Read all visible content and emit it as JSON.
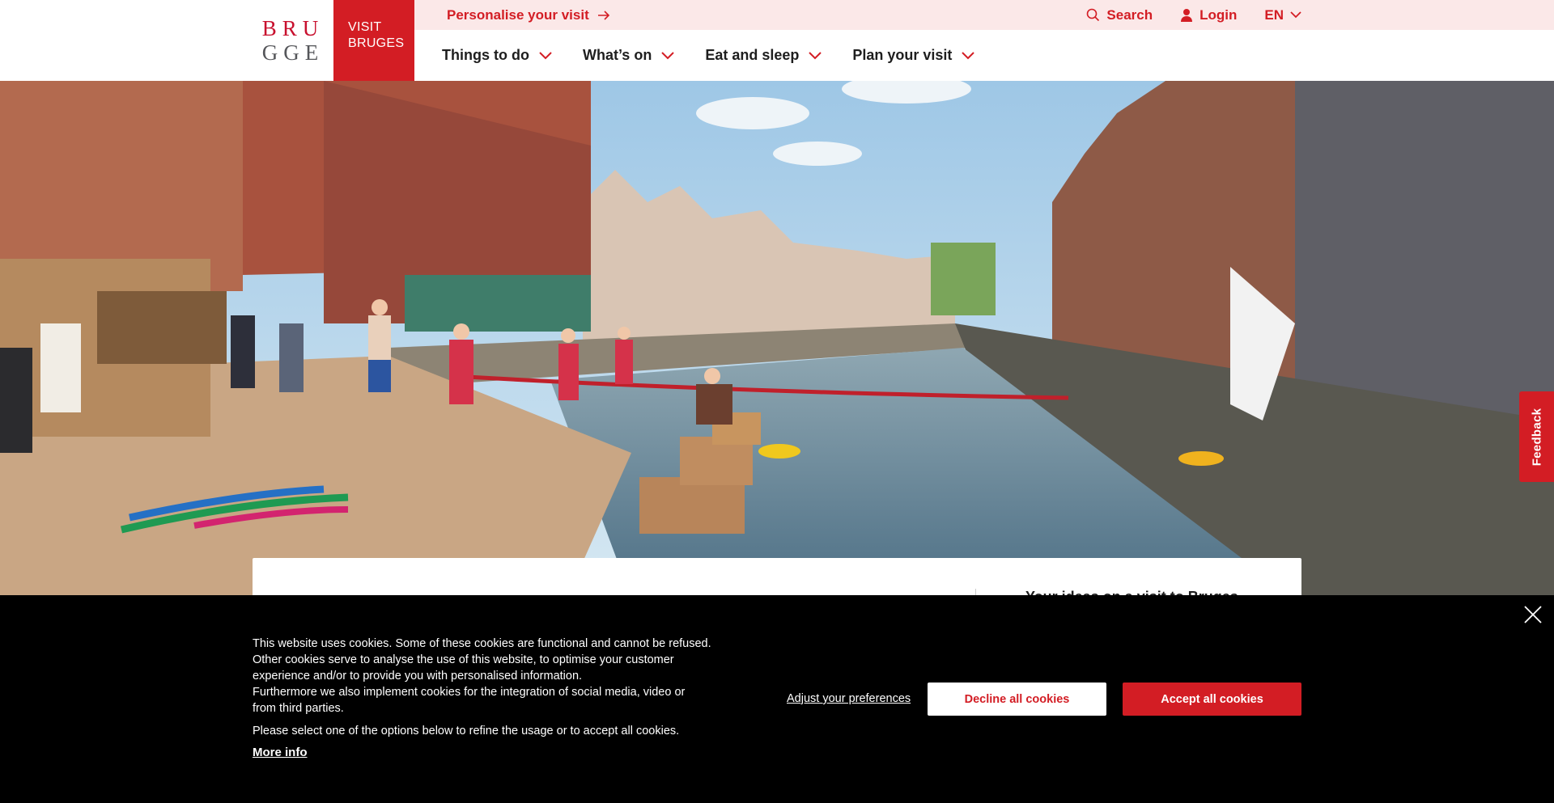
{
  "header": {
    "logo": {
      "row1": "BRU",
      "row2": "GGE"
    },
    "visit_line1": "VISIT",
    "visit_line2": "BRUGES",
    "personalise": "Personalise your visit",
    "search": "Search",
    "login": "Login",
    "language": "EN",
    "nav": [
      "Things to do",
      "What’s on",
      "Eat and sleep",
      "Plan your visit"
    ]
  },
  "hero": {
    "alt": "Swimmers and lifeguards at an open-air canal swimming spot in Bruges"
  },
  "card": {
    "teaser": "Your ideas on a visit to Bruges"
  },
  "feedback": "Feedback",
  "cookie": {
    "p1_l1": "This website uses cookies. Some of these cookies are functional and cannot be refused.",
    "p1_l2": "Other cookies serve to analyse the use of this website, to optimise your customer",
    "p1_l3": "experience and/or to provide you with personalised information.",
    "p1_l4": "Furthermore we also implement cookies for the integration of social media, video or",
    "p1_l5": "from third parties.",
    "p2": "Please select one of the options below to refine the usage or to accept all cookies.",
    "more_info": "More info",
    "adjust": "Adjust your preferences",
    "decline": "Decline all cookies",
    "accept": "Accept all cookies"
  },
  "colors": {
    "brand_red": "#d31d24",
    "topbar_pink": "#fbe8e8",
    "cookie_bg": "#000000"
  },
  "icons": [
    "arrow-right-icon",
    "search-icon",
    "user-icon",
    "chevron-down-icon",
    "close-icon"
  ]
}
